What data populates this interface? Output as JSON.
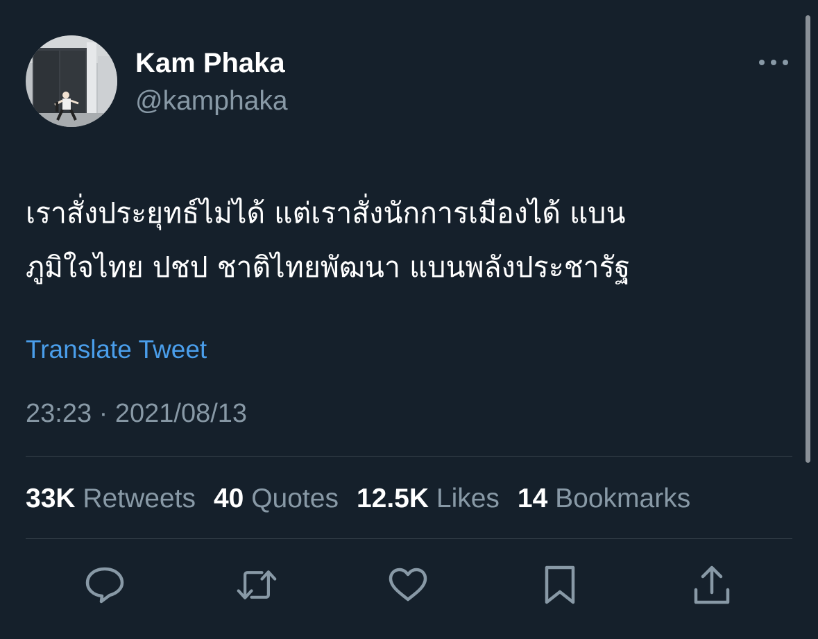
{
  "author": {
    "name": "Kam Phaka",
    "handle": "@kamphaka",
    "avatar": "avatar-photo"
  },
  "tweet": {
    "text_lines": [
      "เราสั่งประยุทธ์ไม่ได้ แต่เราสั่งนักการเมืองได้ แบน",
      "ภูมิใจไทย ปชป ชาติไทยพัฒนา แบนพลังประชารัฐ"
    ],
    "translate_label": "Translate Tweet",
    "timestamp": "23:23 · 2021/08/13"
  },
  "stats": [
    {
      "count": "33K",
      "label": "Retweets"
    },
    {
      "count": "40",
      "label": "Quotes"
    },
    {
      "count": "12.5K",
      "label": "Likes"
    },
    {
      "count": "14",
      "label": "Bookmarks"
    }
  ],
  "actions": [
    {
      "name": "reply",
      "icon": "reply-icon"
    },
    {
      "name": "retweet",
      "icon": "retweet-icon"
    },
    {
      "name": "like",
      "icon": "heart-icon"
    },
    {
      "name": "bookmark",
      "icon": "bookmark-icon"
    },
    {
      "name": "share",
      "icon": "share-icon"
    }
  ],
  "colors": {
    "background": "#15202b",
    "primary_text": "#ffffff",
    "secondary_text": "#8899a6",
    "link": "#4a9eeb",
    "divider": "#38444d"
  }
}
